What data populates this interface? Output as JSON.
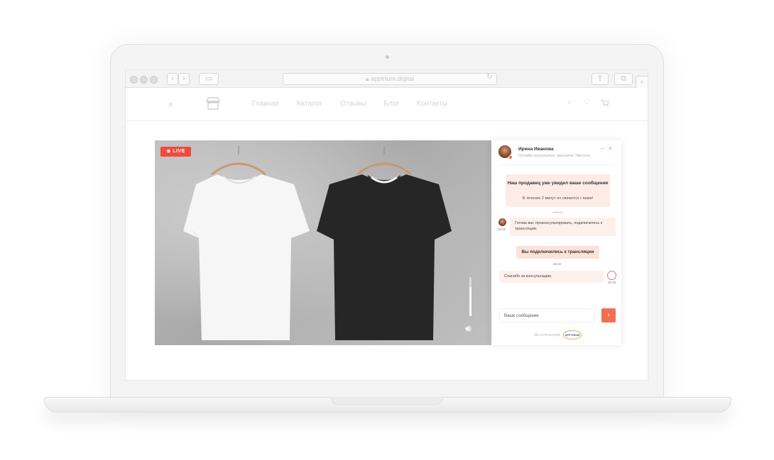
{
  "browser": {
    "url": "apptrium.digital"
  },
  "site": {
    "nav": [
      "Главная",
      "Каталог",
      "Отзывы",
      "Блог",
      "Контакты"
    ]
  },
  "video": {
    "live_label": "LIVE",
    "volume_level": 0.75
  },
  "chat": {
    "agent_name": "Ирина Иванова",
    "agent_role": "Онлайн консультант, магазина 'Чистота'",
    "minimize_label": "–",
    "close_label": "×",
    "notice_title": "Наш продавец уже увидел ваше сообщение",
    "notice_sub": "В течение 2 минут он свяжется с вами!",
    "messages": [
      {
        "from": "agent",
        "text": "Готова вас проконсультировать, подключитесь к трансляции.",
        "time": "22:22"
      },
      {
        "from": "system",
        "text": "Вы подключились к трансляции",
        "time": "22:22"
      },
      {
        "from": "user",
        "text": "Спасибо за консультацию.",
        "time": "22:32"
      }
    ],
    "input_placeholder": "Ваше сообщение",
    "send_icon": "›",
    "powered_by": "Мы используем",
    "brand": "APPTRIUM"
  },
  "colors": {
    "accent": "#f07055",
    "live": "#f04a3c",
    "bubble": "#fdf0ec"
  }
}
